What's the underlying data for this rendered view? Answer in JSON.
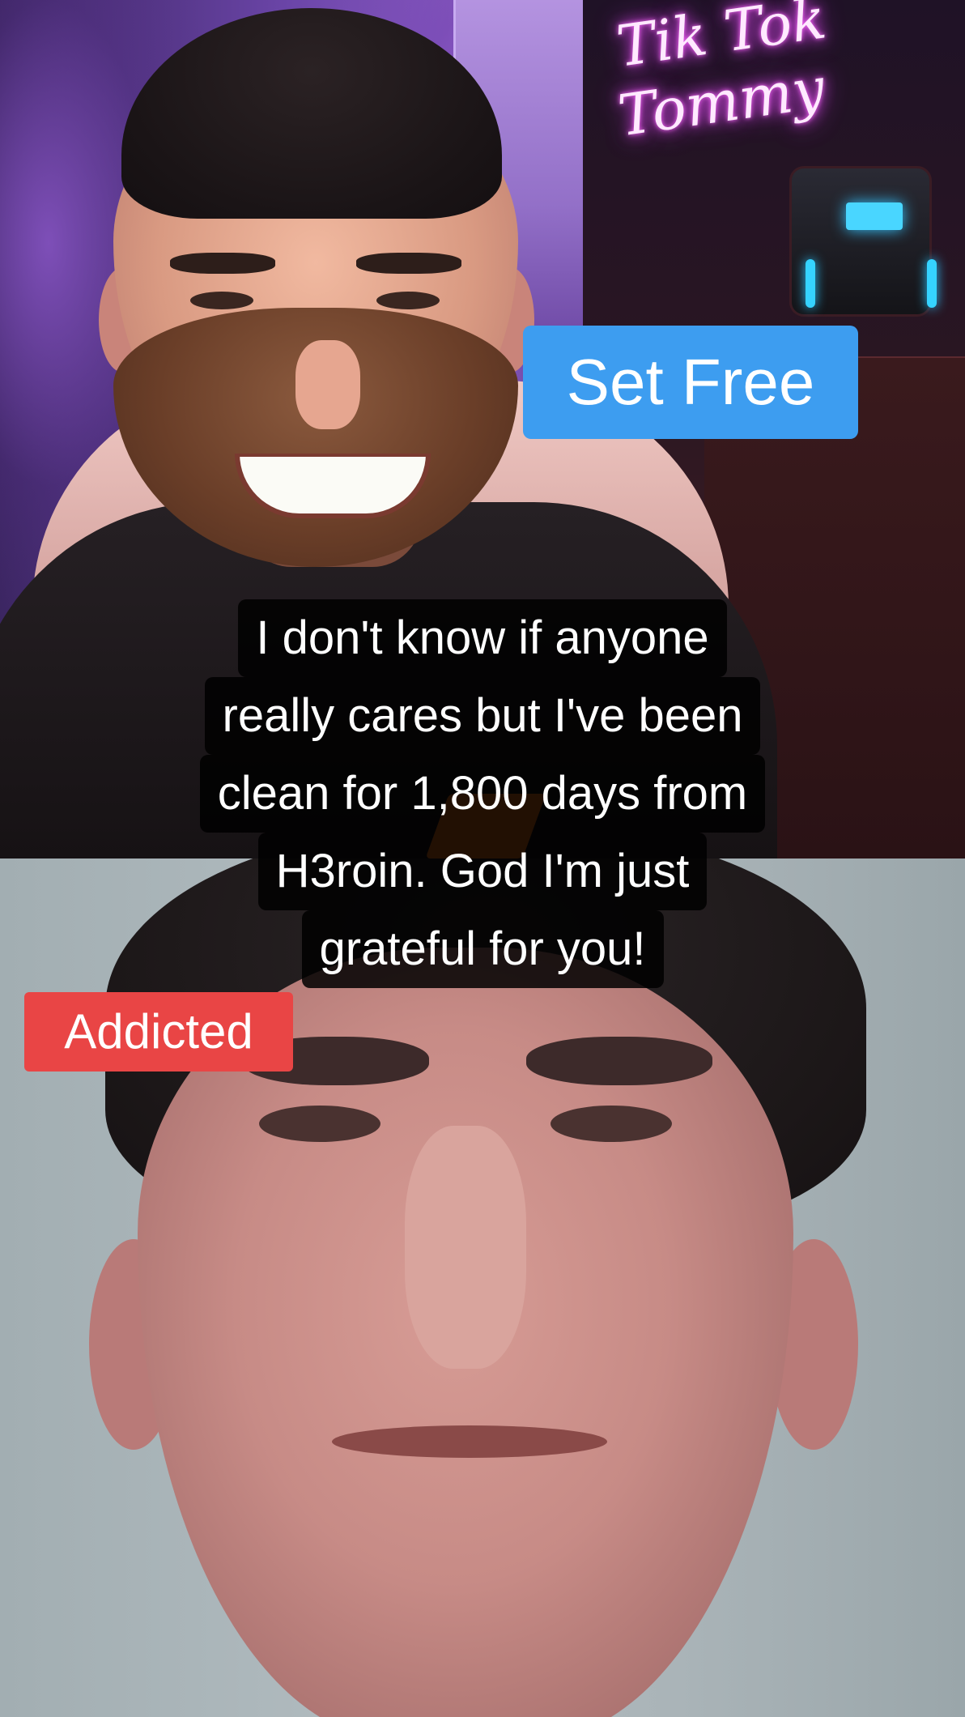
{
  "neon_sign": {
    "line1": "Tik Tok",
    "line2": "Tommy"
  },
  "labels": {
    "top": "Set Free",
    "bottom": "Addicted"
  },
  "caption": {
    "lines": [
      "I don't know if anyone",
      "really cares but I've been",
      "clean for 1,800 days from",
      "H3roin. God I'm just",
      "grateful for you!"
    ]
  },
  "colors": {
    "set_free_bg": "#3d9df0",
    "addicted_bg": "#e94545",
    "caption_bg": "#000000",
    "neon_glow": "#e04bf0"
  }
}
